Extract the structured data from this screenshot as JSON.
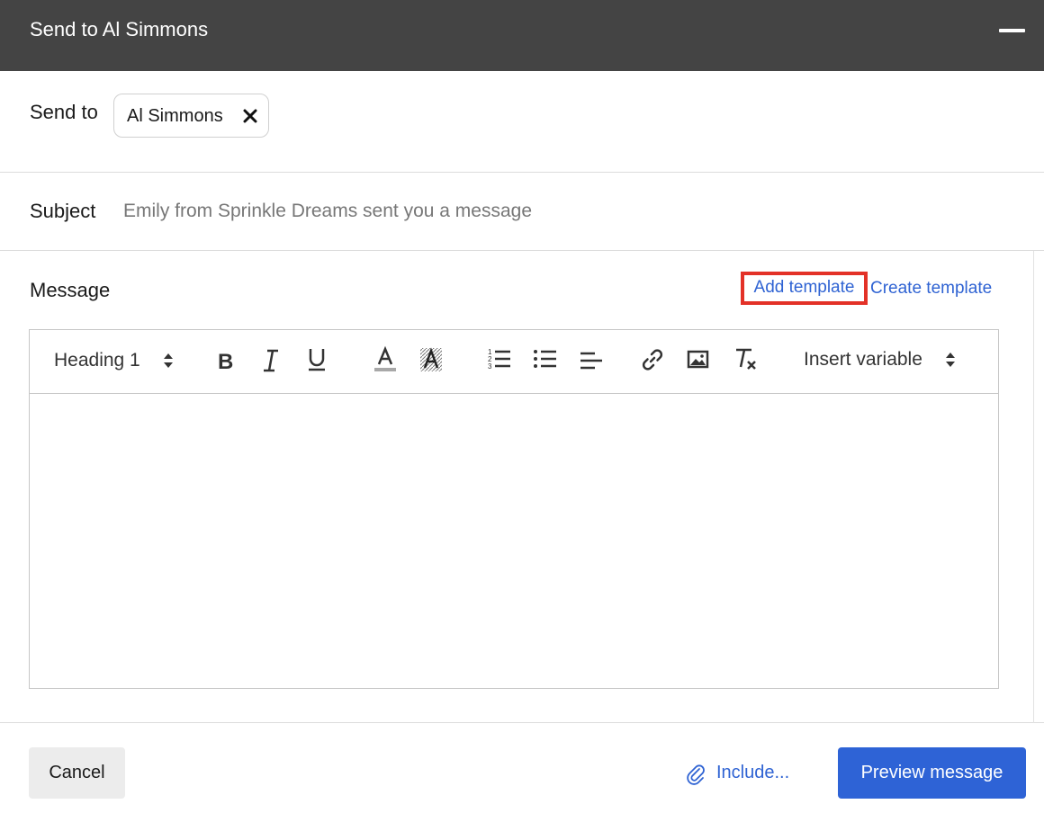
{
  "window": {
    "title": "Send to Al Simmons"
  },
  "send_to": {
    "label": "Send to",
    "recipient": "Al Simmons"
  },
  "subject": {
    "label": "Subject",
    "placeholder": "Emily from Sprinkle Dreams sent you a message"
  },
  "message": {
    "label": "Message",
    "add_template": "Add template",
    "create_template": "Create template",
    "highlight_color": "#e33127"
  },
  "toolbar": {
    "heading_select": "Heading 1",
    "insert_variable": "Insert variable",
    "buttons": [
      "bold-icon",
      "italic-icon",
      "underline-icon",
      "text-color-icon",
      "highlight-icon",
      "ordered-list-icon",
      "bullet-list-icon",
      "align-left-icon",
      "link-icon",
      "image-icon",
      "clear-format-icon"
    ]
  },
  "footer": {
    "cancel": "Cancel",
    "include": "Include...",
    "preview": "Preview message",
    "accent": "#2e63d6"
  }
}
